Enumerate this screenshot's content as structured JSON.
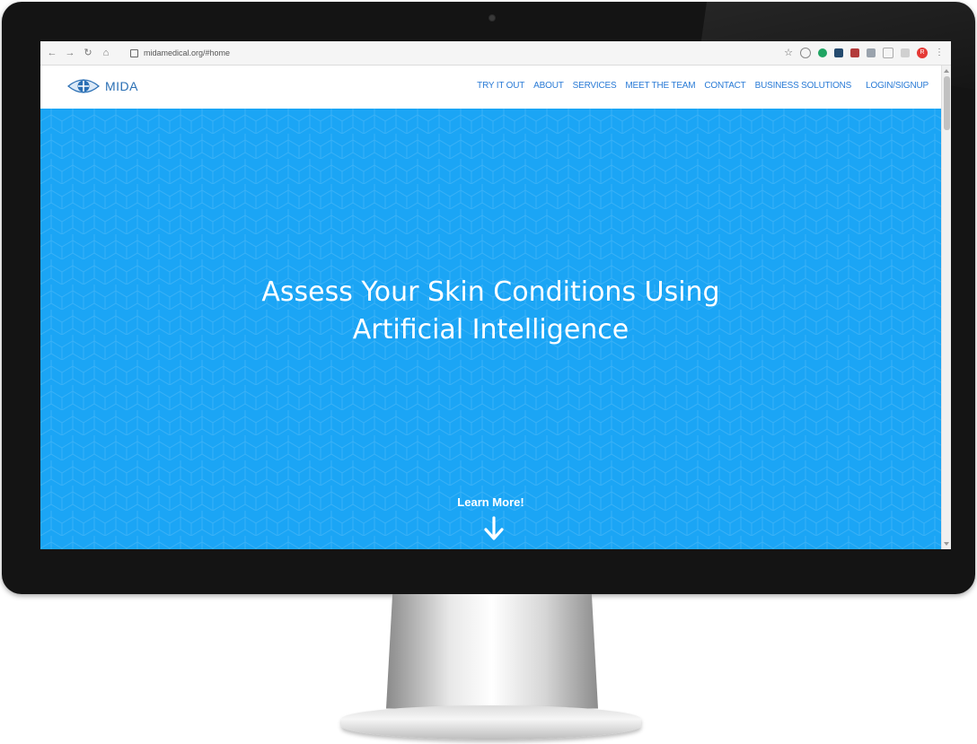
{
  "browser": {
    "url": "midamedical.org/#home",
    "profile_initial": "R"
  },
  "site": {
    "logo_text": "MIDA",
    "nav": [
      "TRY IT OUT",
      "ABOUT",
      "SERVICES",
      "MEET THE TEAM",
      "CONTACT",
      "BUSINESS SOLUTIONS",
      "LOGIN/SIGNUP"
    ]
  },
  "hero": {
    "title_line1": "Assess Your Skin Conditions Using",
    "title_line2": "Artificial Intelligence",
    "learn_more": "Learn More!",
    "background_color": "#1ba5f5"
  },
  "colors": {
    "nav_link": "#2a7bd6",
    "bezel": "#141414"
  }
}
